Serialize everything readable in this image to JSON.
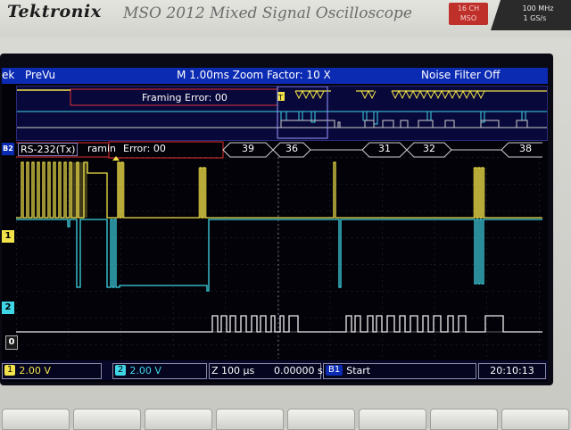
{
  "bezel": {
    "brand": "Tektronix",
    "model": "MSO 2012 Mixed Signal Oscilloscope",
    "badge_channels": [
      "16 CH",
      "MSO"
    ],
    "badge_specs": [
      "100 MHz",
      "1 GS/s"
    ]
  },
  "topbar": {
    "left_partial": "ek",
    "mode": "PreVu",
    "zoom": "M 1.00ms Zoom Factor: 10 X",
    "noise_filter": "Noise Filter Off"
  },
  "overview": {
    "framing_label": "Framing Error: 00",
    "trigger_marker": "T"
  },
  "bus": {
    "marker": "B2",
    "source": "RS-232(Tx)",
    "framing_partial": "ramin",
    "framing_rest": "Error: 00",
    "values": [
      "39",
      "36",
      "31",
      "32",
      "38"
    ]
  },
  "channels": {
    "ch1_marker": "1",
    "ch2_marker": "2",
    "d0_marker": "0"
  },
  "status": {
    "ch1_tag": "1",
    "ch1_scale": "2.00 V",
    "ch2_tag": "2",
    "ch2_scale": "2.00 V",
    "timebase": "Z 100 µs",
    "position": "0.00000 s",
    "trigger_tag": "B1",
    "trigger_mode": "Start",
    "clock": "20:10:13"
  },
  "colors": {
    "ch1": "#f2e24a",
    "ch2": "#3fd6e6",
    "digital": "#f0f0f0",
    "bus_error": "#e03030",
    "topbar": "#0c2bb3"
  },
  "softkeys": [
    "",
    "",
    "",
    "",
    "",
    "",
    "",
    ""
  ]
}
